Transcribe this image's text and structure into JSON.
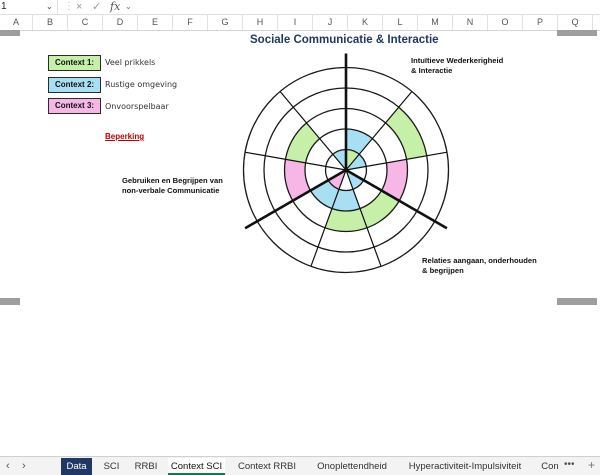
{
  "formula_bar": {
    "name_box": "1",
    "cancel_icon": "×",
    "enter_icon": "✓",
    "fx_label": "fx"
  },
  "columns": [
    "A",
    "B",
    "C",
    "D",
    "E",
    "F",
    "G",
    "H",
    "I",
    "J",
    "K",
    "L",
    "M",
    "N",
    "O",
    "P",
    "Q"
  ],
  "title": "Sociale Communicatie & Interactie",
  "legend": [
    {
      "label": "Context 1:",
      "text": "Veel prikkels",
      "color": "#c6efa8"
    },
    {
      "label": "Context 2:",
      "text": "Rustige omgeving",
      "color": "#a8dff2"
    },
    {
      "label": "Context 3:",
      "text": "Onvoorspelbaar",
      "color": "#f6b6e6"
    }
  ],
  "beperking": "Beperking",
  "chart_labels": {
    "top_right_line1": "Intuïtieve Wederkerigheid",
    "top_right_line2": "& Interactie",
    "left_line1": "Gebruiken en Begrijpen van",
    "left_line2": "non-verbale Communicatie",
    "bottom_right_line1": "Relaties aangaan, onderhouden",
    "bottom_right_line2": "& begrijpen"
  },
  "chart_data": {
    "type": "radial",
    "rings": 5,
    "sectors": 9,
    "groups": [
      "Intuïtieve Wederkerigheid & Interactie",
      "Relaties aangaan, onderhouden & begrijpen",
      "Gebruiken en Begrijpen van non-verbale Communicatie"
    ],
    "filled": [
      {
        "sector": 0,
        "context": "Context 1",
        "level": 1
      },
      {
        "sector": 0,
        "context": "Context 2",
        "level": 2
      },
      {
        "sector": 1,
        "context": "Context 1",
        "level": 4
      },
      {
        "sector": 1,
        "context": "Context 2",
        "level": 1
      },
      {
        "sector": 2,
        "context": "Context 3",
        "level": 3
      },
      {
        "sector": 3,
        "context": "Context 1",
        "level": 3
      },
      {
        "sector": 3,
        "context": "Context 2",
        "level": 1
      },
      {
        "sector": 4,
        "context": "Context 2",
        "level": 2
      },
      {
        "sector": 4,
        "context": "Context 1",
        "level": 3
      },
      {
        "sector": 5,
        "context": "Context 3",
        "level": 1
      },
      {
        "sector": 5,
        "context": "Context 2",
        "level": 2
      },
      {
        "sector": 6,
        "context": "Context 3",
        "level": 3
      },
      {
        "sector": 7,
        "context": "Context 1",
        "level": 3
      },
      {
        "sector": 8,
        "context": "Context 2",
        "level": 1
      }
    ]
  },
  "tabs": [
    {
      "label": "Data",
      "kind": "data"
    },
    {
      "label": "SCI",
      "kind": "normal"
    },
    {
      "label": "RRBI",
      "kind": "normal"
    },
    {
      "label": "Context SCI",
      "kind": "active"
    },
    {
      "label": "Context RRBI",
      "kind": "normal"
    },
    {
      "label": "Onoplettendheid",
      "kind": "normal"
    },
    {
      "label": "Hyperactiviteit-Impulsiviteit",
      "kind": "normal"
    },
    {
      "label": "Con",
      "kind": "normal"
    }
  ],
  "more_tabs": "•••",
  "add_sheet": "+",
  "nav": {
    "prev": "‹",
    "next": "›"
  },
  "icons": [
    "chevron-down-icon",
    "cancel-icon",
    "check-icon",
    "function-icon",
    "scroll-left-icon",
    "scroll-right-icon",
    "more-icon",
    "add-icon"
  ]
}
